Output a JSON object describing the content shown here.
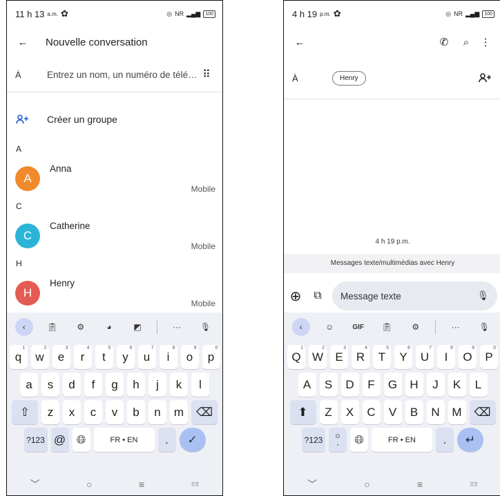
{
  "left": {
    "status": {
      "time": "11 h 13",
      "ampm": "a.m.",
      "network": "NR",
      "battery": "100"
    },
    "appbar": {
      "title": "Nouvelle conversation"
    },
    "to": {
      "label": "À",
      "placeholder": "Entrez un nom, un numéro de télé…"
    },
    "group": {
      "label": "Créer un groupe"
    },
    "contacts": [
      {
        "section": "A",
        "initial": "A",
        "name": "Anna",
        "type": "Mobile",
        "color": "#f08a2b"
      },
      {
        "section": "C",
        "initial": "C",
        "name": "Catherine",
        "type": "Mobile",
        "color": "#2bb4d8"
      },
      {
        "section": "H",
        "initial": "H",
        "name": "Henry",
        "type": "Mobile",
        "color": "#e35b52"
      }
    ],
    "keyboard": {
      "row1": [
        [
          "q",
          "1"
        ],
        [
          "w",
          "2"
        ],
        [
          "e",
          "3"
        ],
        [
          "r",
          "4"
        ],
        [
          "t",
          "5"
        ],
        [
          "y",
          "6"
        ],
        [
          "u",
          "7"
        ],
        [
          "i",
          "8"
        ],
        [
          "o",
          "9"
        ],
        [
          "p",
          "0"
        ]
      ],
      "row2": [
        "a",
        "s",
        "d",
        "f",
        "g",
        "h",
        "j",
        "k",
        "l"
      ],
      "row3": [
        "z",
        "x",
        "c",
        "v",
        "b",
        "n",
        "m"
      ],
      "sym": "?123",
      "at": "@",
      "space": "FR • EN",
      "period": "."
    }
  },
  "right": {
    "status": {
      "time": "4 h 19",
      "ampm": "p.m.",
      "network": "NR",
      "battery": "100"
    },
    "to": {
      "label": "À",
      "chip": "Henry"
    },
    "timestamp": "4 h 19 p.m.",
    "info": "Messages texte/multimédias avec Henry",
    "compose": {
      "placeholder": "Message texte"
    },
    "keyboard": {
      "gif": "GIF",
      "row1": [
        [
          "Q",
          "1"
        ],
        [
          "W",
          "2"
        ],
        [
          "E",
          "3"
        ],
        [
          "R",
          "4"
        ],
        [
          "T",
          "5"
        ],
        [
          "Y",
          "6"
        ],
        [
          "U",
          "7"
        ],
        [
          "I",
          "8"
        ],
        [
          "O",
          "9"
        ],
        [
          "P",
          "0"
        ]
      ],
      "row2": [
        "A",
        "S",
        "D",
        "F",
        "G",
        "H",
        "J",
        "K",
        "L"
      ],
      "row3": [
        "Z",
        "X",
        "C",
        "V",
        "B",
        "N",
        "M"
      ],
      "sym": "?123",
      "emoji_sub": ",",
      "space": "FR • EN",
      "period": "."
    }
  }
}
